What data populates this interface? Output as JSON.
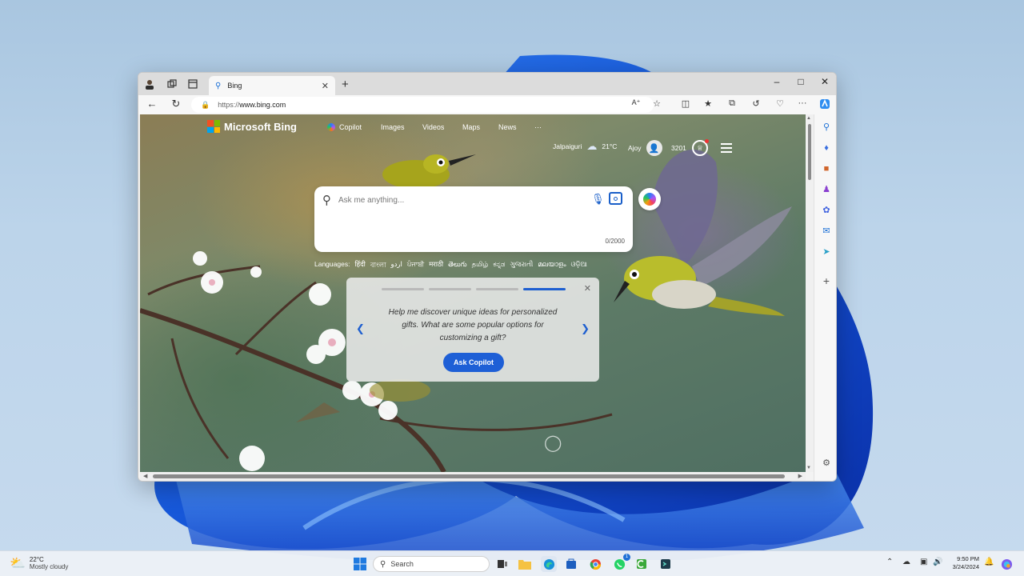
{
  "browser": {
    "tab": {
      "title": "Bing"
    },
    "address": {
      "protocol": "https://",
      "host": "www.bing.com"
    }
  },
  "page": {
    "brand": "Microsoft Bing",
    "nav": [
      "Copilot",
      "Images",
      "Videos",
      "Maps",
      "News",
      "···"
    ],
    "location": "Jalpaiguri",
    "temperature": "21°C",
    "user": "Ajoy",
    "points": "3201",
    "search": {
      "placeholder": "Ask me anything...",
      "counter": "0/2000"
    },
    "languages": {
      "label": "Languages:",
      "items": [
        "हिंदी",
        "বাংলা",
        "اردو",
        "ਪੰਜਾਬੀ",
        "मराठी",
        "తెలుగు",
        "தமிழ்",
        "ಕನ್ನಡ",
        "ગુજરાતી",
        "മലയാളം",
        "ଓଡ଼ିଆ"
      ]
    },
    "promo": {
      "text": "Help me discover unique ideas for personalized gifts. What are some popular options for customizing a gift?",
      "button": "Ask Copilot",
      "active_step": 4,
      "total_steps": 4
    }
  },
  "taskbar": {
    "weather": {
      "temp": "22°C",
      "condition": "Mostly cloudy"
    },
    "search_placeholder": "Search",
    "whatsapp_badge": "1",
    "time": "9:50 PM",
    "date": "3/24/2024"
  },
  "colors": {
    "accent": "#1e5fd6",
    "ms_red": "#f25022",
    "ms_green": "#7fba00",
    "ms_blue": "#00a4ef",
    "ms_yellow": "#ffb900"
  }
}
